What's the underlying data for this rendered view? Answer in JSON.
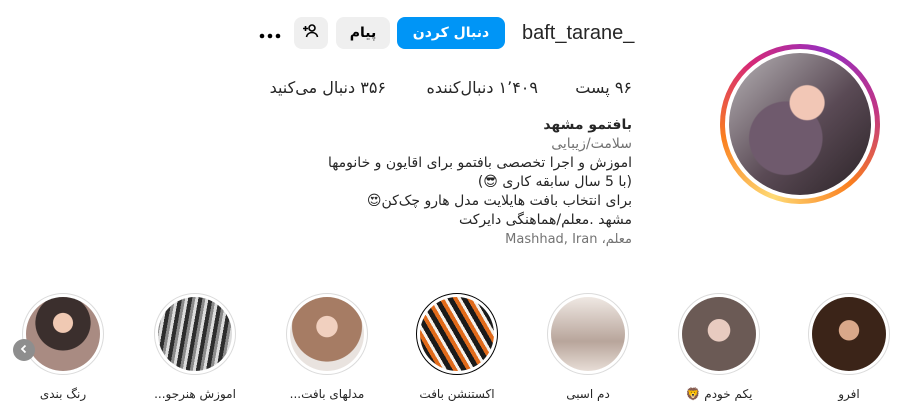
{
  "profile": {
    "username": "baft_tarane_",
    "follow_label": "دنبال کردن",
    "message_label": "پیام",
    "more_label": "•••",
    "posts": "۹۶ پست",
    "followers": "۱٬۴۰۹ دنبال‌کننده",
    "following": "۳۵۶ دنبال می‌کنید",
    "name": "بافتمو مشهد",
    "category": "سلامت/زیبایی",
    "bio_lines": [
      "اموزش و اجرا تخصصی بافتمو برای اقایون و خانومها",
      "(با 5 سال سابقه کاری 😎)",
      "برای انتخاب بافت هایلایت مدل هارو چک‌کن😍",
      "مشهد .معلم/هماهنگی دایرکت"
    ],
    "location": "معلم، Mashhad, Iran"
  },
  "highlights": [
    {
      "label": "افرو",
      "color": "#5a3b2a"
    },
    {
      "label": "یکم خودم 🦁",
      "color": "#b9a7a2"
    },
    {
      "label": "دم اسبی",
      "color": "#cdbfb7"
    },
    {
      "label": "اکستنشن بافت",
      "color": "#e06a1a"
    },
    {
      "label": "مدلهای بافت...",
      "color": "#c9a08a"
    },
    {
      "label": "اموزش هنرجو...",
      "color": "#6f6f6f"
    },
    {
      "label": "رنگ بندی",
      "color": "#8c6f68"
    }
  ],
  "icons": {
    "more": "more-horizontal-icon",
    "suggest": "person-add-icon",
    "prev": "chevron-left-icon"
  }
}
